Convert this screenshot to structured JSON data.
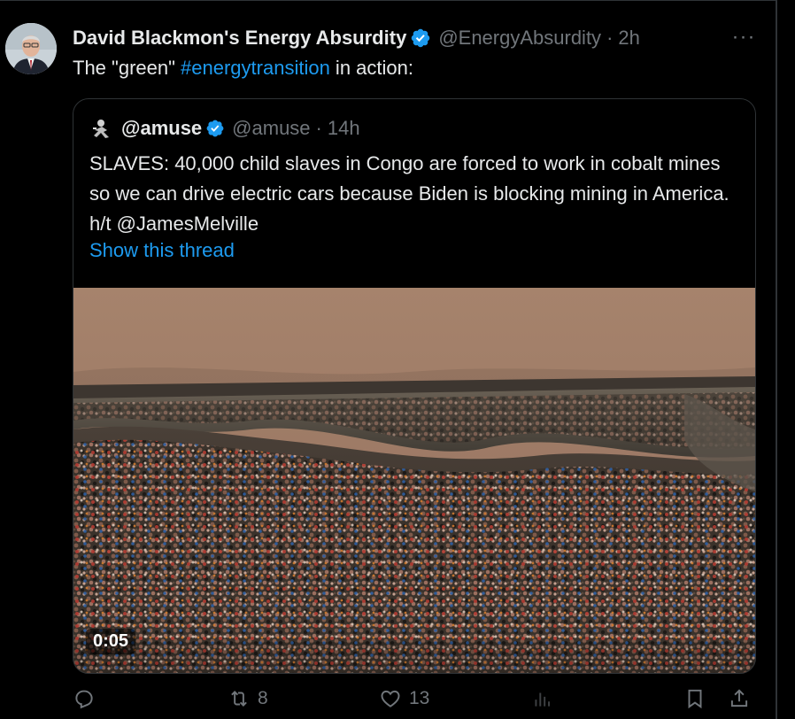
{
  "tweet": {
    "author_name": "David Blackmon's Energy Absurdity",
    "handle": "@EnergyAbsurdity",
    "separator": "·",
    "time": "2h",
    "more_label": "···",
    "text_before": "The \"green\" ",
    "hashtag": "#energytransition",
    "text_after": " in action:"
  },
  "quote": {
    "name": "@amuse",
    "handle": "@amuse",
    "separator": "·",
    "time": "14h",
    "text": "SLAVES: 40,000 child slaves in Congo are forced to work in cobalt mines so we can drive electric cars because Biden is blocking mining in America. h/t @JamesMelville",
    "show_thread": "Show this thread",
    "video_duration": "0:05"
  },
  "actions": {
    "reply_count": "",
    "retweet_count": "8",
    "like_count": "13",
    "views_count": ""
  },
  "colors": {
    "background": "#000000",
    "text": "#e7e9ea",
    "muted": "#71767b",
    "accent": "#1d9bf0",
    "border": "#2f3336"
  },
  "icons": [
    "verified-badge-icon",
    "more-icon",
    "reply-icon",
    "retweet-icon",
    "like-icon",
    "views-icon",
    "bookmark-icon",
    "share-icon"
  ]
}
